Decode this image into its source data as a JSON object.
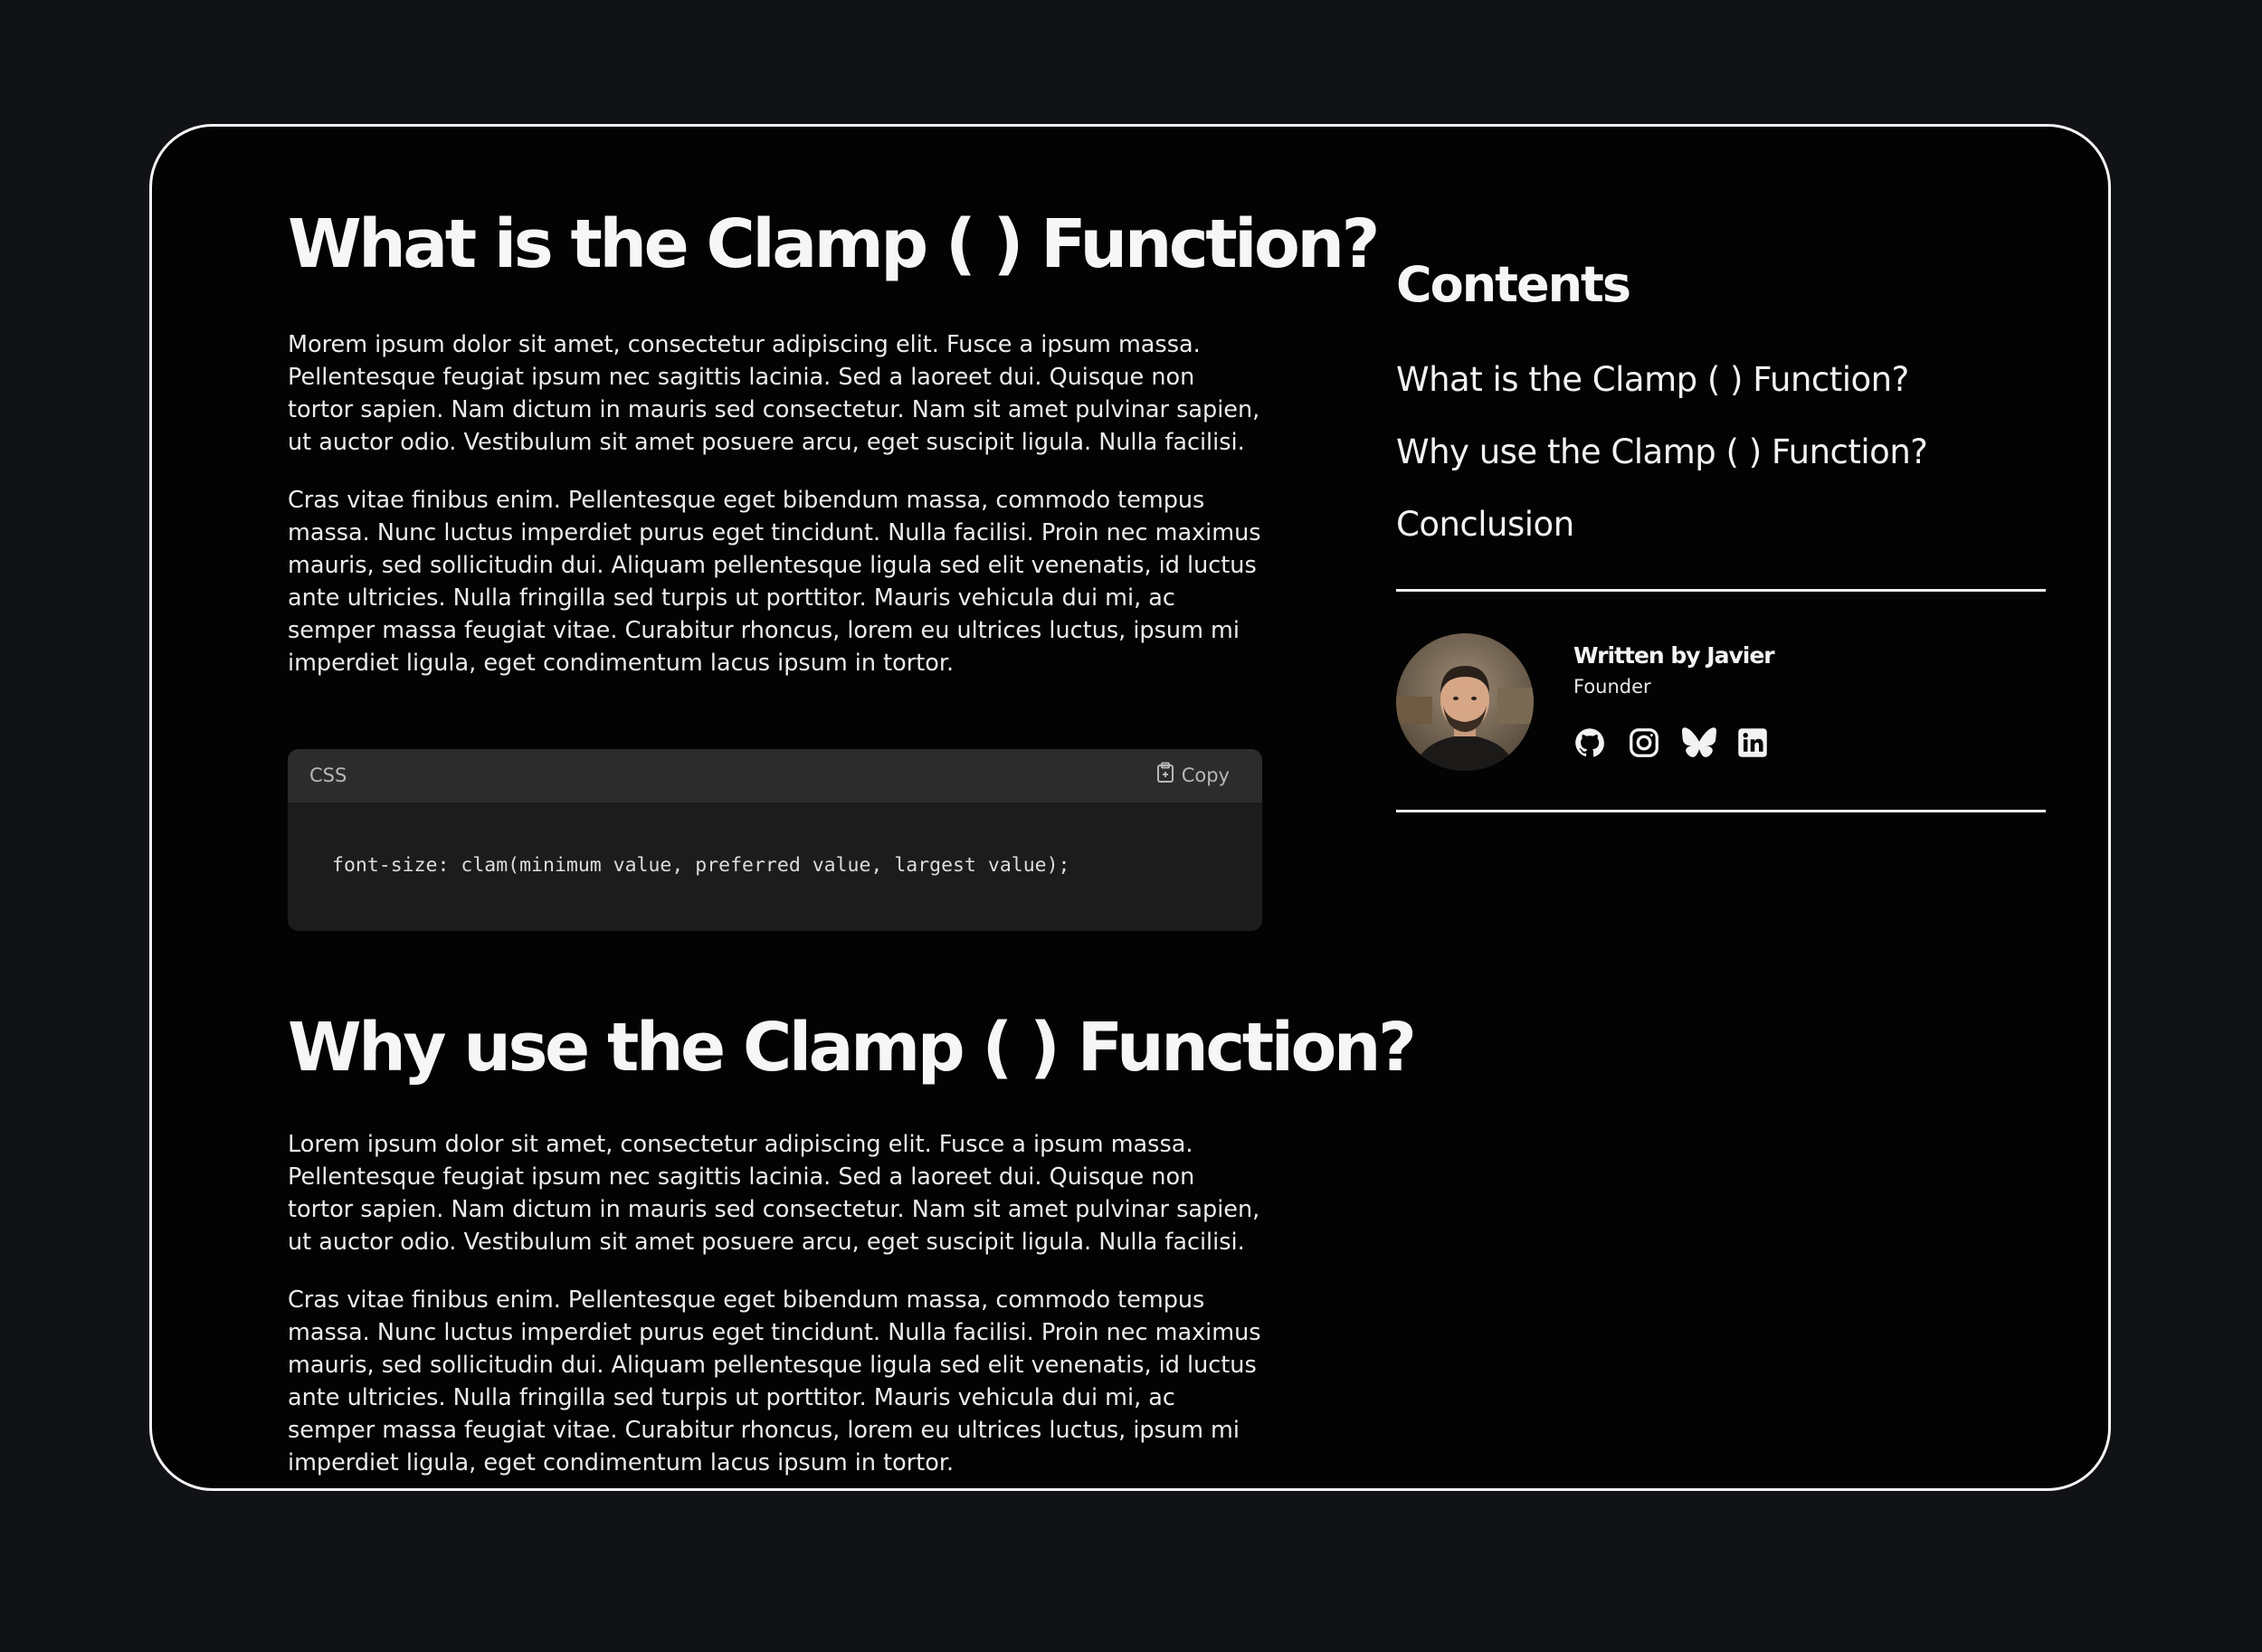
{
  "article": {
    "section1": {
      "heading": "What is the Clamp ( ) Function?",
      "paragraph1": "Morem ipsum dolor sit amet, consectetur adipiscing elit. Fusce a ipsum massa. Pellentesque feugiat ipsum nec sagittis lacinia. Sed a laoreet dui. Quisque non tortor sapien. Nam dictum in mauris sed consectetur. Nam sit amet pulvinar sapien, ut auctor odio. Vestibulum sit amet posuere arcu, eget suscipit ligula. Nulla facilisi.",
      "paragraph2": "Cras vitae finibus enim. Pellentesque eget bibendum massa, commodo tempus massa. Nunc luctus imperdiet purus eget tincidunt. Nulla facilisi. Proin nec maximus mauris, sed sollicitudin dui. Aliquam pellentesque ligula sed elit venenatis, id luctus ante ultricies. Nulla fringilla sed turpis ut porttitor. Mauris vehicula dui mi, ac semper massa feugiat vitae. Curabitur rhoncus, lorem eu ultrices luctus, ipsum mi imperdiet ligula, eget condimentum lacus ipsum in tortor."
    },
    "code": {
      "language": "CSS",
      "copy_label": "Copy",
      "line": "font-size: clam(minimum value, preferred value, largest value);"
    },
    "section2": {
      "heading": "Why use the Clamp ( ) Function?",
      "paragraph1": "Lorem ipsum dolor sit amet, consectetur adipiscing elit. Fusce a ipsum massa. Pellentesque feugiat ipsum nec sagittis lacinia. Sed a laoreet dui. Quisque non tortor sapien. Nam dictum in mauris sed consectetur. Nam sit amet pulvinar sapien, ut auctor odio. Vestibulum sit amet posuere arcu, eget suscipit ligula. Nulla facilisi.",
      "paragraph2": "Cras vitae finibus enim. Pellentesque eget bibendum massa, commodo tempus massa. Nunc luctus imperdiet purus eget tincidunt. Nulla facilisi. Proin nec maximus mauris, sed sollicitudin dui. Aliquam pellentesque ligula sed elit venenatis, id luctus ante ultricies. Nulla fringilla sed turpis ut porttitor. Mauris vehicula dui mi, ac semper massa feugiat vitae. Curabitur rhoncus, lorem eu ultrices luctus, ipsum mi imperdiet ligula, eget condimentum lacus ipsum in tortor."
    }
  },
  "contents": {
    "title": "Contents",
    "items": [
      {
        "label": "What is the Clamp ( ) Function?"
      },
      {
        "label": "Why use the Clamp ( ) Function?"
      },
      {
        "label": "Conclusion"
      }
    ]
  },
  "author": {
    "name": "Written by Javier",
    "role": "Founder",
    "socials": [
      {
        "icon": "github-icon"
      },
      {
        "icon": "instagram-icon"
      },
      {
        "icon": "bluesky-icon"
      },
      {
        "icon": "linkedin-icon"
      }
    ]
  },
  "colors": {
    "page_background": "#111216",
    "card_background": "#030303",
    "card_border": "#f4f4f4",
    "code_background": "#1c1c1c",
    "code_header": "#2c2c2c"
  }
}
